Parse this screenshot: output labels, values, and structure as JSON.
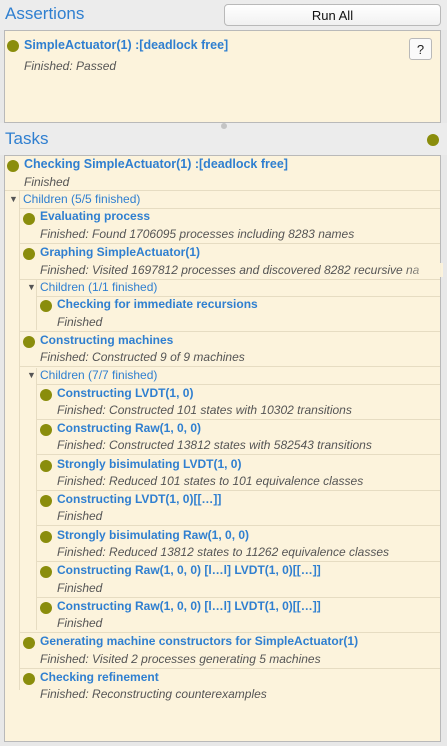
{
  "assertions": {
    "title": "Assertions",
    "run_all_label": "Run All",
    "help_label": "?",
    "item": {
      "name": "SimpleActuator(1) :[deadlock free]",
      "status": "Finished: Passed"
    }
  },
  "tasks": {
    "title": "Tasks",
    "root": {
      "name": "Checking SimpleActuator(1) :[deadlock free]",
      "status": "Finished"
    },
    "children_label": "Children (5/5 finished)",
    "evaluating": {
      "name": "Evaluating process",
      "status": "Finished: Found 1706095 processes including 8283 names"
    },
    "graphing": {
      "name": "Graphing SimpleActuator(1)",
      "status": "Finished: Visited 1697812 processes and discovered 8282 recursive na",
      "children_label": "Children (1/1 finished)",
      "child": {
        "name": "Checking for immediate recursions",
        "status": "Finished"
      }
    },
    "constructing": {
      "name": "Constructing machines",
      "status": "Finished: Constructed 9 of 9 machines",
      "children_label": "Children (7/7 finished)",
      "children": [
        {
          "name": "Constructing LVDT(1, 0)",
          "status": "Finished: Constructed 101 states with 10302 transitions"
        },
        {
          "name": "Constructing Raw(1, 0, 0)",
          "status": "Finished: Constructed 13812 states with 582543 transitions"
        },
        {
          "name": "Strongly bisimulating LVDT(1, 0)",
          "status": "Finished: Reduced 101 states to 101 equivalence classes"
        },
        {
          "name": "Constructing LVDT(1, 0)[[…]]",
          "status": "Finished"
        },
        {
          "name": "Strongly bisimulating Raw(1, 0, 0)",
          "status": "Finished: Reduced 13812 states to 11262 equivalence classes"
        },
        {
          "name": "Constructing Raw(1, 0, 0) [l…l] LVDT(1, 0)[[…]]",
          "status": "Finished"
        },
        {
          "name": "Constructing Raw(1, 0, 0) [l…l] LVDT(1, 0)[[…]]",
          "status": "Finished"
        }
      ]
    },
    "generating": {
      "name": "Generating machine constructors for SimpleActuator(1)",
      "status": "Finished: Visited 2 processes generating 5 machines"
    },
    "refinement": {
      "name": "Checking refinement",
      "status": "Finished: Reconstructing counterexamples"
    }
  },
  "colors": {
    "accent": "#2f7fd0",
    "status_dot": "#8a8d0c",
    "panel_bg": "#fcf3dc"
  }
}
